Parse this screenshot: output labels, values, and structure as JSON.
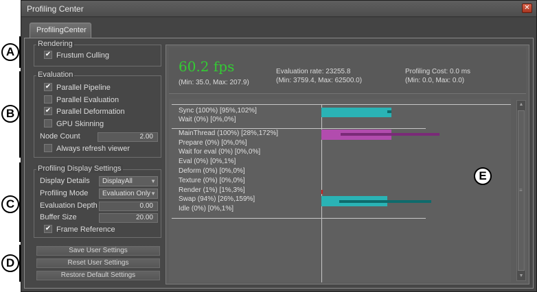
{
  "window": {
    "title": "Profiling Center",
    "close_glyph": "✕"
  },
  "tab": {
    "label": "ProfilingCenter"
  },
  "rendering": {
    "title": "Rendering",
    "frustum_culling": {
      "label": "Frustum Culling",
      "checked": true
    }
  },
  "evaluation": {
    "title": "Evaluation",
    "options": [
      {
        "label": "Parallel Pipeline",
        "checked": true
      },
      {
        "label": "Parallel Evaluation",
        "checked": false
      },
      {
        "label": "Parallel Deformation",
        "checked": true
      },
      {
        "label": "GPU Skinning",
        "checked": false
      }
    ],
    "node_count": {
      "label": "Node Count",
      "value": "2.00"
    },
    "always_refresh": {
      "label": "Always refresh viewer",
      "checked": false
    }
  },
  "display_settings": {
    "title": "Profiling Display Settings",
    "display_details": {
      "label": "Display Details",
      "value": "DisplayAll"
    },
    "profiling_mode": {
      "label": "Profiling Mode",
      "value": "Evaluation Only"
    },
    "evaluation_depth": {
      "label": "Evaluation Depth",
      "value": "0.00"
    },
    "buffer_size": {
      "label": "Buffer Size",
      "value": "20.00"
    },
    "frame_reference": {
      "label": "Frame Reference",
      "checked": true
    }
  },
  "buttons": {
    "save": "Save User Settings",
    "reset": "Reset User Settings",
    "restore": "Restore Default Settings"
  },
  "stats": {
    "fps": "60.2 fps",
    "fps_range": "(Min: 35.0, Max: 207.9)",
    "eval_rate": "Evaluation rate: 23255.8",
    "eval_range": "(Min: 3759.4, Max: 62500.0)",
    "cost": "Profiling Cost: 0.0 ms",
    "cost_range": "(Min: 0.0, Max: 0.0)"
  },
  "graph_labels": [
    "Sync (100%) [95%,102%]",
    "Wait (0%) [0%,0%]",
    "MainThread (100%) [28%,172%]",
    "Prepare (0%) [0%,0%]",
    "Wait for eval (0%) [0%,0%]",
    "Eval (0%) [0%,1%]",
    "Deform (0%) [0%,0%]",
    "Texture (0%) [0%,0%]",
    "Render (1%) [1%,3%]",
    "Swap (94%) [26%,159%]",
    "Idle (0%) [0%,1%]"
  ],
  "colors": {
    "teal": "#2ab3b5",
    "teal_dark": "#0e6b6c",
    "magenta": "#b24cae",
    "magenta_dark": "#7a2a78",
    "fps_green": "#33cc33",
    "render_red": "#cc2222"
  },
  "callouts": [
    "A",
    "B",
    "C",
    "D",
    "E"
  ],
  "icons": {
    "checkmark": "✔",
    "combo_arrow": "▼",
    "scroll_up": "▲",
    "scroll_down": "▼",
    "grip": "≡"
  }
}
